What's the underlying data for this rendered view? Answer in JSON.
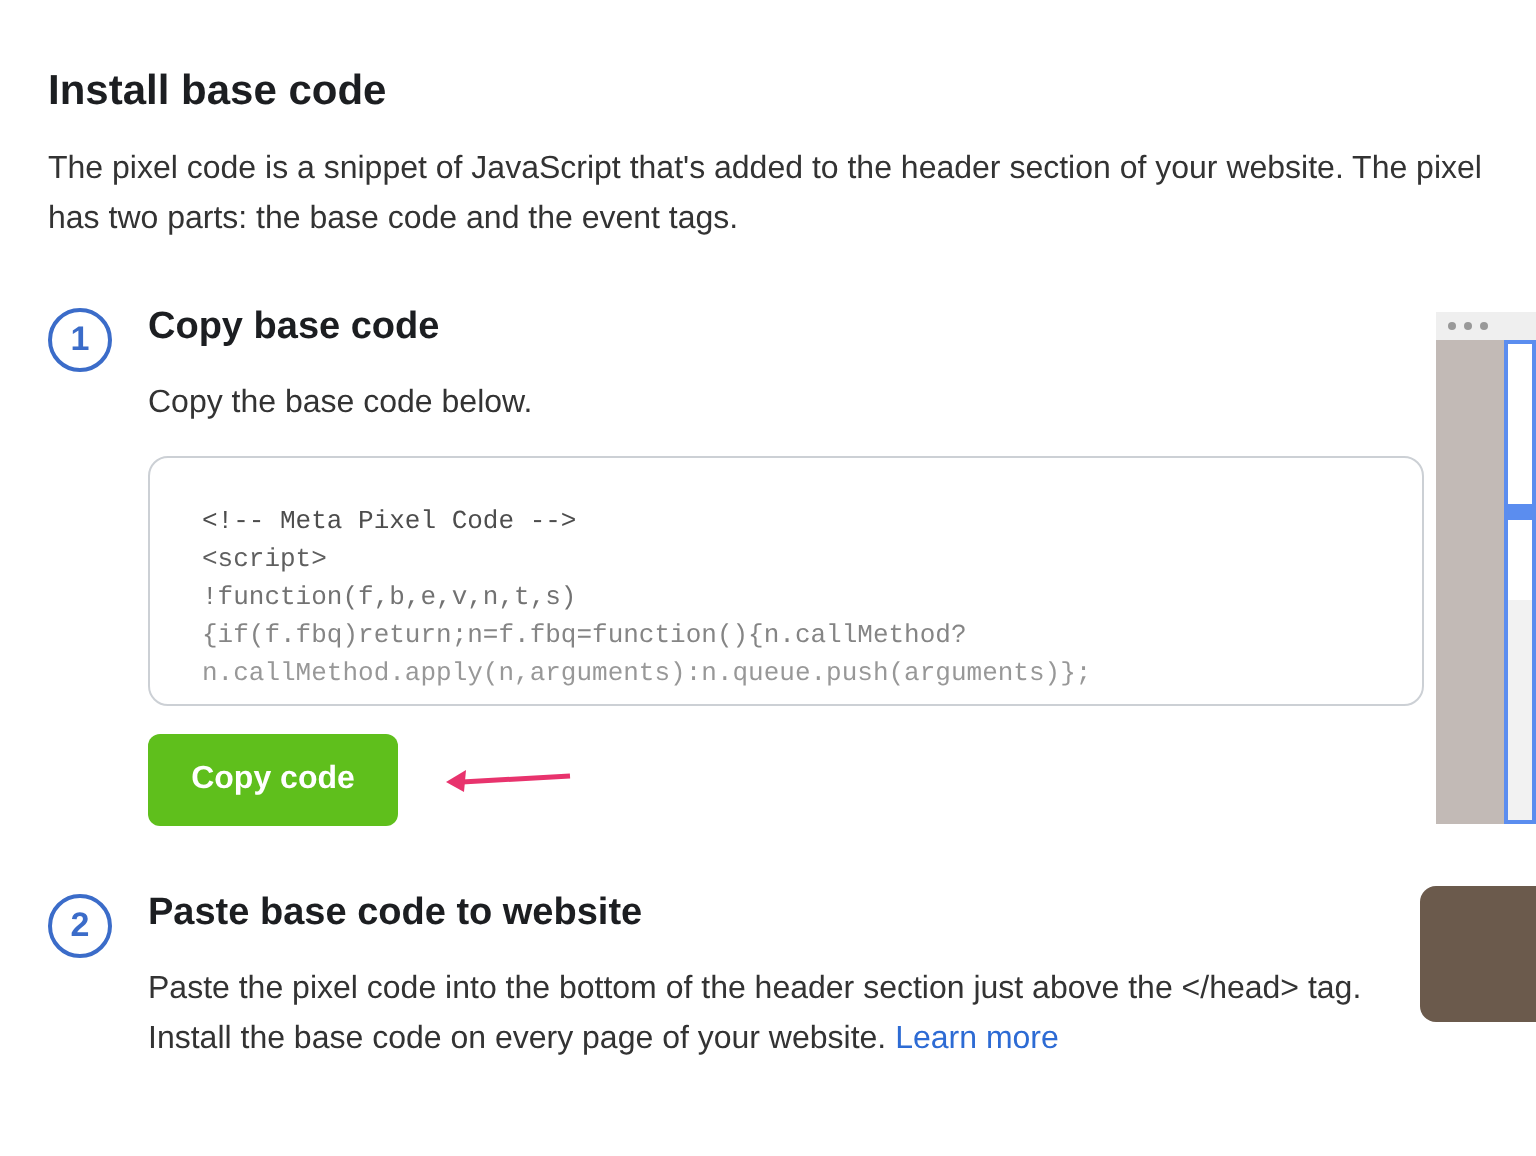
{
  "heading": "Install base code",
  "intro": "The pixel code is a snippet of JavaScript that's added to the header section of your website. The pixel has two parts: the base code and the event tags.",
  "steps": [
    {
      "number": "1",
      "title": "Copy base code",
      "text": "Copy the base code below.",
      "code_lines": [
        "<!-- Meta Pixel Code -->",
        "<script>",
        "!function(f,b,e,v,n,t,s)",
        "{if(f.fbq)return;n=f.fbq=function(){n.callMethod?",
        "n.callMethod.apply(n,arguments):n.queue.push(arguments)};"
      ],
      "button": "Copy code",
      "kind": "copy"
    },
    {
      "number": "2",
      "title": "Paste base code to website",
      "text": "Paste the pixel code into the bottom of the header section just above the </head> tag. Install the base code on every page of your website.",
      "link": "Learn more",
      "kind": "paste"
    }
  ]
}
